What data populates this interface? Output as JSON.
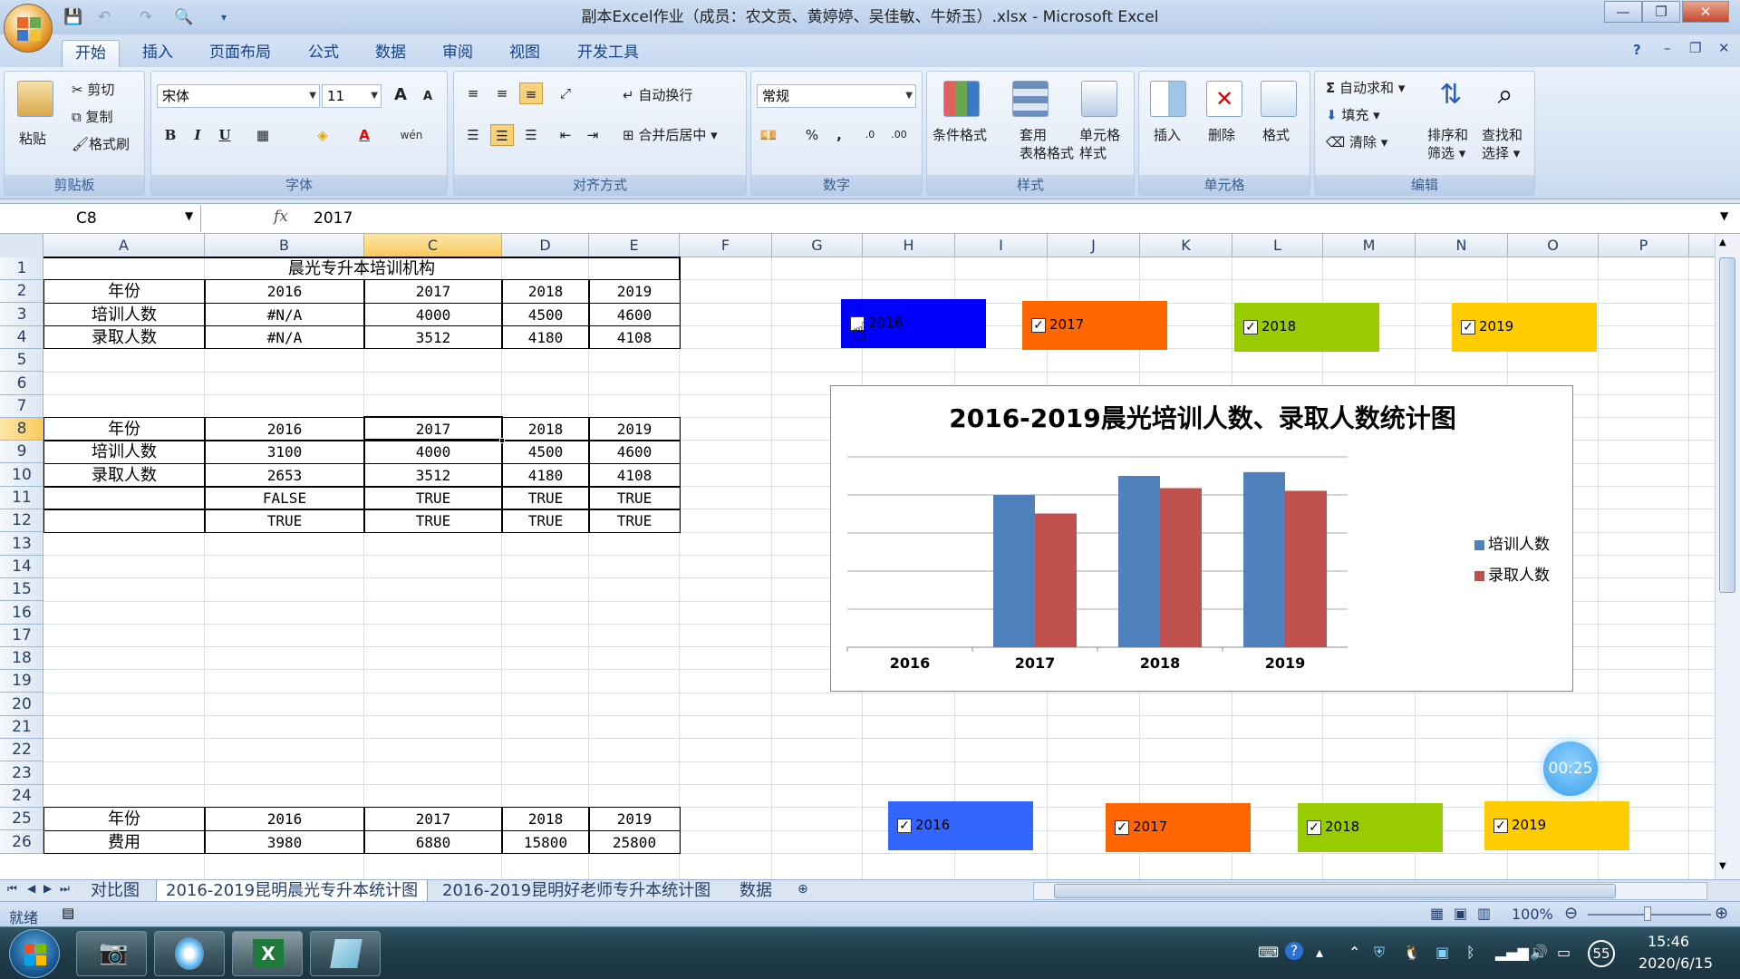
{
  "window": {
    "title": "副本Excel作业（成员：农文贡、黄婷婷、吴佳敏、牛娇玉）.xlsx - Microsoft Excel",
    "min": "—",
    "max": "❐",
    "close": "✕"
  },
  "ribbon_tabs": [
    "开始",
    "插入",
    "页面布局",
    "公式",
    "数据",
    "审阅",
    "视图",
    "开发工具"
  ],
  "clipboard": {
    "paste": "粘贴",
    "cut": "剪切",
    "copy": "复制",
    "format_painter": "格式刷",
    "label": "剪贴板"
  },
  "font": {
    "name": "宋体",
    "size": "11",
    "grow": "A",
    "shrink": "A",
    "bold": "B",
    "italic": "I",
    "underline": "U",
    "wen": "wén",
    "label": "字体"
  },
  "alignment": {
    "wrap": "自动换行",
    "merge": "合并后居中",
    "label": "对齐方式"
  },
  "number": {
    "format": "常规",
    "percent": "%",
    "comma": ",",
    "inc": ".0",
    "dec": ".00",
    "label": "数字"
  },
  "styles": {
    "conditional": "条件格式",
    "table1": "套用",
    "table2": "表格格式",
    "cell1": "单元格",
    "cell2": "样式",
    "label": "样式"
  },
  "cells": {
    "insert": "插入",
    "delete": "删除",
    "format": "格式",
    "label": "单元格"
  },
  "editing": {
    "autosum": "自动求和",
    "fill": "填充",
    "clear": "清除",
    "sort1": "排序和",
    "sort2": "筛选",
    "find1": "查找和",
    "find2": "选择",
    "label": "编辑"
  },
  "formula_bar": {
    "name_box": "C8",
    "fx": "fx",
    "value": "2017"
  },
  "columns": [
    "A",
    "B",
    "C",
    "D",
    "E",
    "F",
    "G",
    "H",
    "I",
    "J",
    "K",
    "L",
    "M",
    "N",
    "O",
    "P"
  ],
  "selected_column": "C",
  "selected_row": "8",
  "rows": [
    "1",
    "2",
    "3",
    "4",
    "5",
    "6",
    "7",
    "8",
    "9",
    "10",
    "11",
    "12",
    "13",
    "14",
    "15",
    "16",
    "17",
    "18",
    "19",
    "20",
    "21",
    "22",
    "23",
    "24",
    "25",
    "26"
  ],
  "table1": {
    "title": "晨光专升本培训机构",
    "rows": [
      [
        "年份",
        "2016",
        "2017",
        "2018",
        "2019"
      ],
      [
        "培训人数",
        "#N/A",
        "4000",
        "4500",
        "4600"
      ],
      [
        "录取人数",
        "#N/A",
        "3512",
        "4180",
        "4108"
      ]
    ]
  },
  "table2": {
    "rows": [
      [
        "年份",
        "2016",
        "2017",
        "2018",
        "2019"
      ],
      [
        "培训人数",
        "3100",
        "4000",
        "4500",
        "4600"
      ],
      [
        "录取人数",
        "2653",
        "3512",
        "4180",
        "4108"
      ],
      [
        "",
        "FALSE",
        "TRUE",
        "TRUE",
        "TRUE"
      ],
      [
        "",
        "TRUE",
        "TRUE",
        "TRUE",
        "TRUE"
      ]
    ]
  },
  "table3": {
    "rows": [
      [
        "年份",
        "2016",
        "2017",
        "2018",
        "2019"
      ],
      [
        "费用",
        "3980",
        "6880",
        "15800",
        "25800"
      ]
    ]
  },
  "checkboxes_top": [
    {
      "label": "2016",
      "checked": false,
      "color": "#0000ff"
    },
    {
      "label": "2017",
      "checked": true,
      "color": "#ff6600"
    },
    {
      "label": "2018",
      "checked": true,
      "color": "#99cc00"
    },
    {
      "label": "2019",
      "checked": true,
      "color": "#ffcc00"
    }
  ],
  "checkboxes_bottom": [
    {
      "label": "2016",
      "checked": true,
      "color": "#3366ff"
    },
    {
      "label": "2017",
      "checked": true,
      "color": "#ff6600"
    },
    {
      "label": "2018",
      "checked": true,
      "color": "#99cc00"
    },
    {
      "label": "2019",
      "checked": true,
      "color": "#ffcc00"
    }
  ],
  "chart_data": {
    "type": "bar",
    "title": "2016-2019晨光培训人数、录取人数统计图",
    "categories": [
      "2016",
      "2017",
      "2018",
      "2019"
    ],
    "series": [
      {
        "name": "培训人数",
        "color": "#4f81bd",
        "values": [
          null,
          4000,
          4500,
          4600
        ]
      },
      {
        "name": "录取人数",
        "color": "#c0504d",
        "values": [
          null,
          3512,
          4180,
          4108
        ]
      }
    ],
    "ylim": [
      0,
      5000
    ],
    "grid": true,
    "legend": "right"
  },
  "timer": "00:25",
  "sheet_tabs": [
    "对比图",
    "2016-2019昆明晨光专升本统计图",
    "2016-2019昆明好老师专升本统计图",
    "数据"
  ],
  "active_sheet_tab": 1,
  "status": {
    "ready": "就绪",
    "zoom": "100%"
  },
  "taskbar": {
    "time": "15:46",
    "date": "2020/6/15",
    "badge": "55"
  }
}
